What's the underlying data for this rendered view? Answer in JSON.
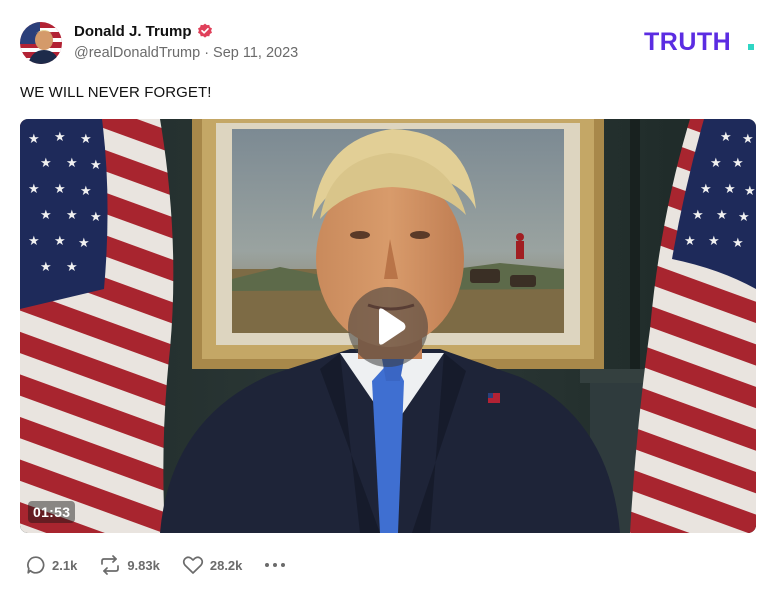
{
  "author": {
    "name": "Donald J. Trump",
    "handle": "@realDonaldTrump",
    "date": "Sep 11, 2023",
    "verified": true
  },
  "brand": {
    "logo_text": "TRUTH.",
    "color": "#5b2ce2",
    "dot_color": "#2fd6c4"
  },
  "post": {
    "text": "WE WILL NEVER FORGET!"
  },
  "video": {
    "duration": "01:53"
  },
  "actions": {
    "replies": "2.1k",
    "retruths": "9.83k",
    "likes": "28.2k"
  },
  "icons": [
    "verified-badge-icon",
    "reply-icon",
    "retruth-icon",
    "like-icon",
    "more-icon",
    "play-icon"
  ]
}
